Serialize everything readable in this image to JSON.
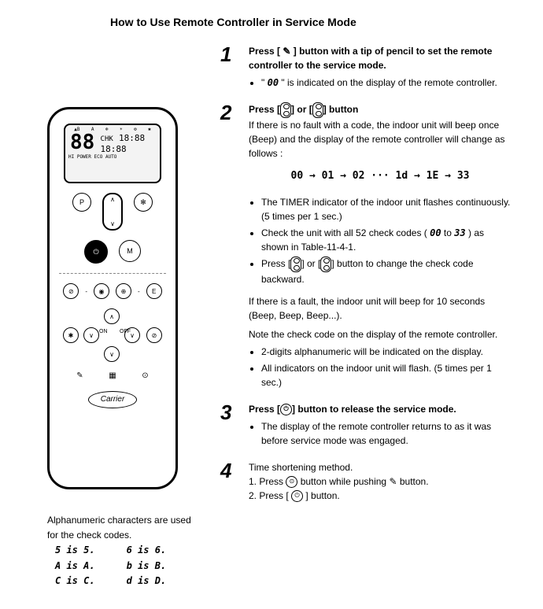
{
  "title": "How to Use Remote Controller in Service Mode",
  "remote": {
    "brand": "Carrier",
    "display_main": "88",
    "display_chk": "CHK",
    "display_clock": "18:88",
    "display_timer": "18:88",
    "indicators": "HI POWER ECO AUTO"
  },
  "steps": {
    "s1": {
      "num": "1",
      "head": "Press [  ] button with a tip of pencil to set the remote controller to the service mode.",
      "pencil_glyph": "✎",
      "bullet1_pre": "\"",
      "bullet1_code": "00",
      "bullet1_post": "\" is indicated on the display of the remote controller."
    },
    "s2": {
      "num": "2",
      "head_pre": "Press [",
      "head_mid": "] or [",
      "head_post": "] button",
      "no_fault": "If there is no fault with a code, the indoor unit will beep once (Beep) and the display of the remote controller will change as follows :",
      "seq": "00  →  01  →  02  ···  1d  →  1E  →  33",
      "b1": "The TIMER indicator of the indoor unit flashes continuously. (5 times per 1 sec.)",
      "b2_pre": "Check the unit with all 52 check codes ( ",
      "b2_from": "00",
      "b2_to": "33",
      "b2_mid": " to ",
      "b2_post": " ) as shown in Table-11-4-1.",
      "b3_pre": "Press [",
      "b3_mid": "] or [",
      "b3_post": "] button to change the check code backward.",
      "fault1": "If there is a fault, the indoor unit will beep for 10 seconds (Beep, Beep, Beep...).",
      "fault2": "Note the check code on the display of the remote controller.",
      "b4": "2-digits alphanumeric will be indicated on the display.",
      "b5": "All indicators on the indoor unit will flash. (5 times per 1 sec.)"
    },
    "s3": {
      "num": "3",
      "head_pre": "Press [",
      "head_post": "] button to release the service mode.",
      "b1": "The display of the remote controller returns to as it was before service mode was engaged."
    },
    "s4": {
      "num": "4",
      "head": "Time shortening method.",
      "l1_pre": "1.  Press ",
      "l1_mid": " button while pushing ",
      "l1_post": " button.",
      "l2_pre": "2.  Press [ ",
      "l2_post": " ] button."
    }
  },
  "char_note": {
    "intro": "Alphanumeric characters are used for the check codes.",
    "col1": [
      "5 is 5.",
      "A is A.",
      "C is C."
    ],
    "col2": [
      "6 is 6.",
      "b is B.",
      "d is D."
    ]
  }
}
